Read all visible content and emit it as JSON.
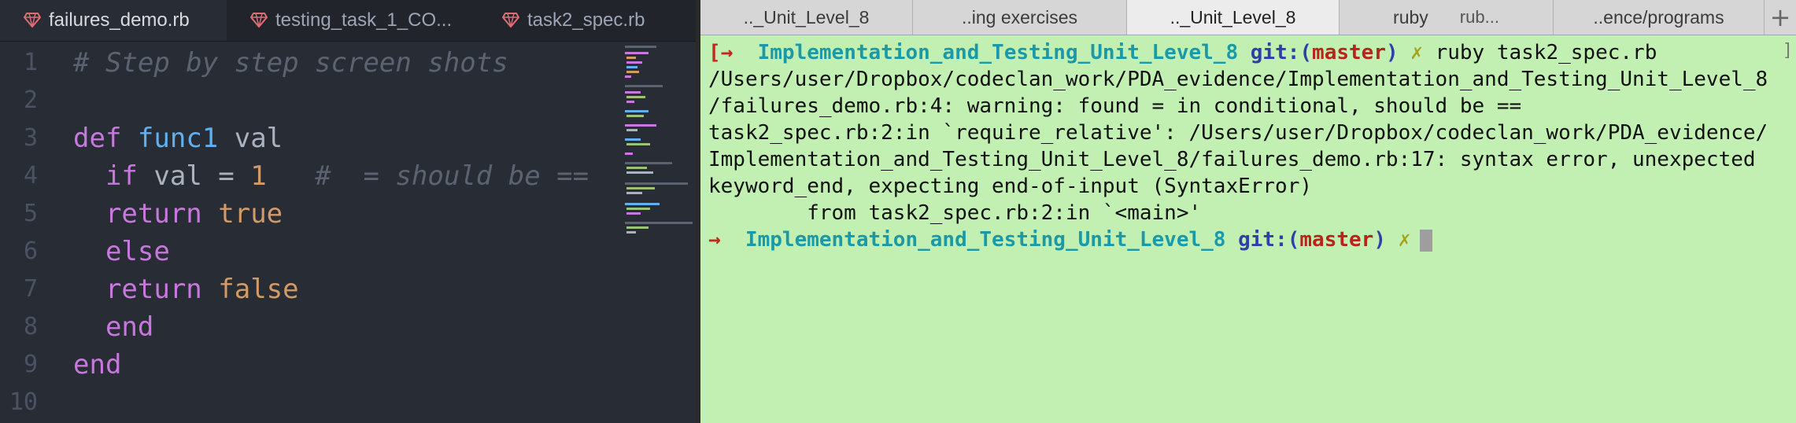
{
  "editor": {
    "tabs": [
      {
        "label": "failures_demo.rb",
        "active": true
      },
      {
        "label": "testing_task_1_CO...",
        "active": false
      },
      {
        "label": "task2_spec.rb",
        "active": false
      }
    ],
    "line_numbers": [
      "1",
      "2",
      "3",
      "4",
      "5",
      "6",
      "7",
      "8",
      "9",
      "10"
    ],
    "code": {
      "line1_comment": "# Step by step screen shots",
      "line3_def": "def",
      "line3_name": "func1",
      "line3_arg": " val",
      "line4_if": "if",
      "line4_cond": " val = ",
      "line4_num": "1",
      "line4_comment": "#  = should be ==",
      "line5_return": "return",
      "line5_val": "true",
      "line6_else": "else",
      "line7_return": "return",
      "line7_val": "false",
      "line8_end": "end",
      "line9_end": "end"
    },
    "icon": "ruby-gem-icon"
  },
  "terminal": {
    "tabs": [
      {
        "label": ".._Unit_Level_8",
        "active": false
      },
      {
        "label": "..ing exercises",
        "active": false
      },
      {
        "label": ".._Unit_Level_8",
        "active": true
      },
      {
        "label": "ruby",
        "sub": "rub...",
        "active": false
      },
      {
        "label": "..ence/programs",
        "active": false
      }
    ],
    "plus": "+",
    "prompt_arrow": "→",
    "prompt_open_bracket": "[",
    "prompt_dir": "Implementation_and_Testing_Unit_Level_8",
    "prompt_git": "git:(",
    "prompt_branch": "master",
    "prompt_close": ")",
    "prompt_x": "✗",
    "command": "ruby task2_spec.rb",
    "output": [
      "/Users/user/Dropbox/codeclan_work/PDA_evidence/Implementation_and_Testing_Unit_Level_8",
      "/failures_demo.rb:4: warning: found = in conditional, should be ==",
      "task2_spec.rb:2:in `require_relative': /Users/user/Dropbox/codeclan_work/PDA_evidence/",
      "Implementation_and_Testing_Unit_Level_8/failures_demo.rb:17: syntax error, unexpected",
      "keyword_end, expecting end-of-input (SyntaxError)",
      "        from task2_spec.rb:2:in `<main>'"
    ],
    "right_bracket": "]"
  },
  "colors": {
    "editor_bg": "#282c34",
    "terminal_bg": "#c2f0b2",
    "keyword": "#c678dd",
    "function": "#61afef",
    "number": "#d19a66"
  }
}
